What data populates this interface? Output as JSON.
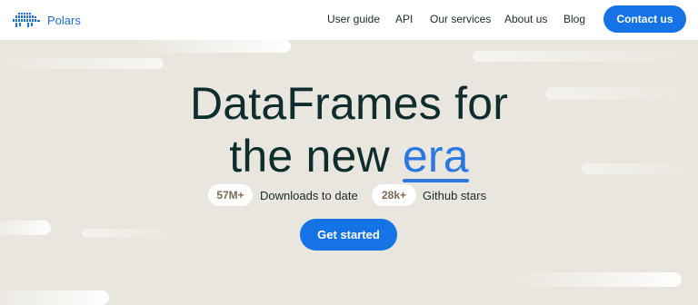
{
  "brand": {
    "name": "Polars",
    "color": "#1d6fe0"
  },
  "nav": {
    "links": [
      "User guide",
      "API",
      "Our services",
      "About us",
      "Blog"
    ],
    "contact_label": "Contact us"
  },
  "hero": {
    "title_line1": "DataFrames for",
    "title_line2_prefix": "the new ",
    "title_accent": "era",
    "stats": [
      {
        "value": "57M+",
        "label": "Downloads to date"
      },
      {
        "value": "28k+",
        "label": "Github stars"
      }
    ],
    "cta_label": "Get started"
  },
  "colors": {
    "background": "#e9e6df",
    "accent": "#1673e6",
    "heading": "#0f2d2c",
    "stat_value": "#7a6a55"
  }
}
